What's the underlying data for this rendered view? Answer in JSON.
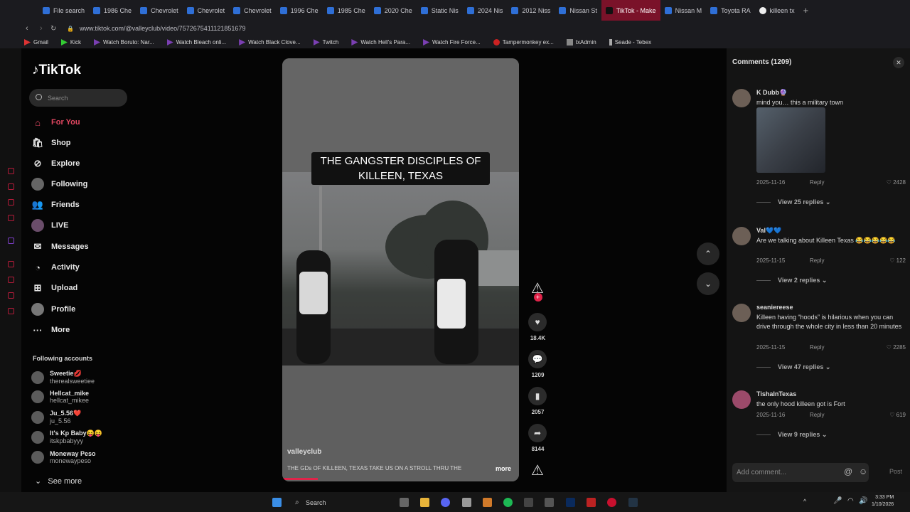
{
  "browser": {
    "tabs": [
      "File search",
      "1986 Che",
      "Chevrolet",
      "Chevrolet",
      "Chevrolet",
      "1996 Che",
      "1985 Che",
      "2020 Che",
      "Static Nis",
      "2024 Nis",
      "2012 Niss",
      "Nissan St",
      "TikTok - Make",
      "Nissan M",
      "Toyota RA",
      "killeen tx"
    ],
    "active_tab": "TikTok - Make",
    "url": "www.tiktok.com/@valleyclub/video/7572675411121851679",
    "bookmarks": [
      "Gmail",
      "Kick",
      "Watch Boruto: Nar...",
      "Watch Bleach onli...",
      "Watch Black Clove...",
      "Twitch",
      "Watch Hell's Para...",
      "Watch Fire Force...",
      "Tampermonkey ex...",
      "txAdmin",
      "Seade - Tebex"
    ]
  },
  "sidebar": {
    "logo": "TikTok",
    "search_placeholder": "Search",
    "nav": [
      "For You",
      "Shop",
      "Explore",
      "Following",
      "Friends",
      "LIVE",
      "Messages",
      "Activity",
      "Upload",
      "Profile",
      "More"
    ],
    "following_title": "Following accounts",
    "accounts": [
      {
        "name": "Sweetie💋",
        "handle": "therealsweetiee"
      },
      {
        "name": "Hellcat_mike",
        "handle": "hellcat_mikee"
      },
      {
        "name": "Ju_5.56❤️",
        "handle": "ju_5.56"
      },
      {
        "name": "It's Kp Baby😝😝",
        "handle": "itskpbabyyy"
      },
      {
        "name": "Moneway Peso",
        "handle": "monewaypeso"
      }
    ],
    "see_more": "See more"
  },
  "video": {
    "caption": "THE GANGSTER DISCIPLES OF KILLEEN, TEXAS",
    "username": "valleyclub",
    "description": "THE GDs OF KILLEEN, TEXAS TAKE US ON A STROLL THRU THE",
    "more": "more",
    "likes": "18.4K",
    "comments": "1209",
    "saves": "2057",
    "shares": "8144",
    "progress": 0.15
  },
  "comments": {
    "title": "Comments (1209)",
    "items": [
      {
        "user": "K Dubb🔮",
        "text": "mind you… this a military town",
        "date": "2025-11-16",
        "reply": "Reply",
        "likes": "2428",
        "view_replies": "View 25 replies"
      },
      {
        "user": "Val💙💙",
        "text": "Are we talking about Killeen Texas 😂😂😂😂😂",
        "date": "2025-11-15",
        "reply": "Reply",
        "likes": "122",
        "view_replies": "View 2 replies"
      },
      {
        "user": "seaniereese",
        "text": "Killeen having “hoods” is hilarious when you can drive through the whole city in less than 20 minutes",
        "date": "2025-11-15",
        "reply": "Reply",
        "likes": "2285",
        "view_replies": "View 47 replies"
      },
      {
        "user": "TishaInTexas",
        "text": "the only hood killeen got is Fort",
        "date": "2025-11-16",
        "reply": "Reply",
        "likes": "619",
        "view_replies": "View 9 replies"
      }
    ],
    "add_placeholder": "Add comment...",
    "post": "Post"
  },
  "taskbar": {
    "search": "Search",
    "time": "3:33 PM",
    "date": "1/10/2026"
  }
}
